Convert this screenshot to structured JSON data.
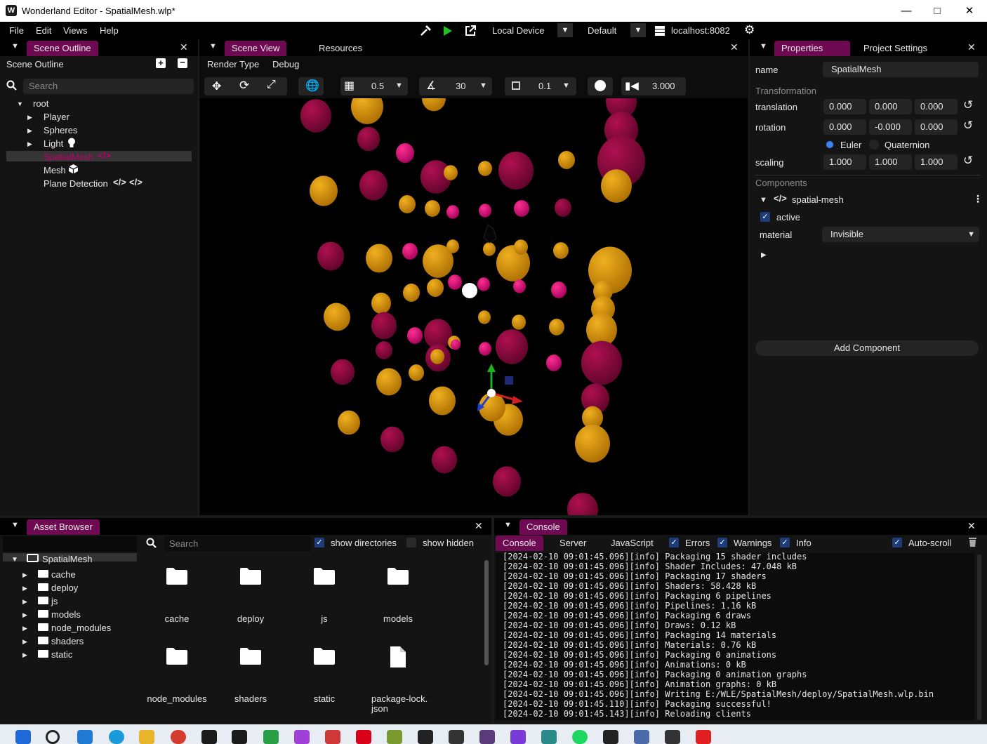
{
  "window": {
    "title": "Wonderland Editor - SpatialMesh.wlp*",
    "logo": "W"
  },
  "menu": [
    "File",
    "Edit",
    "Views",
    "Help"
  ],
  "toolbar": {
    "device": "Local Device",
    "profile": "Default",
    "server": "localhost:8082"
  },
  "scene_outline": {
    "tab": "Scene Outline",
    "header": "Scene Outline",
    "search_placeholder": "Search",
    "root": "root",
    "items": [
      {
        "label": "Player",
        "expandable": true
      },
      {
        "label": "Spheres",
        "expandable": true
      },
      {
        "label": "Light",
        "expandable": true,
        "icon": "light-bulb-icon"
      },
      {
        "label": "SpatialMesh",
        "selected": true,
        "icon": "code-icon"
      },
      {
        "label": "Mesh",
        "icon": "mesh-cube-icon"
      },
      {
        "label": "Plane Detection",
        "icon": "code-icon"
      }
    ]
  },
  "scene_view": {
    "tabs": [
      "Scene View",
      "Resources"
    ],
    "menu": [
      "Render Type",
      "Debug"
    ],
    "grid_size": "0.5",
    "angle_snap": "30",
    "scale_snap": "0.1",
    "camera_speed": "3.000"
  },
  "properties": {
    "tabs": [
      "Properties",
      "Project Settings"
    ],
    "name_label": "name",
    "name_value": "SpatialMesh",
    "transformation": "Transformation",
    "translation_label": "translation",
    "translation": [
      "0.000",
      "0.000",
      "0.000"
    ],
    "rotation_label": "rotation",
    "rotation": [
      "0.000",
      "-0.000",
      "0.000"
    ],
    "euler": "Euler",
    "quaternion": "Quaternion",
    "scaling_label": "scaling",
    "scaling": [
      "1.000",
      "1.000",
      "1.000"
    ],
    "components": "Components",
    "component_name": "spatial-mesh",
    "active_label": "active",
    "material_label": "material",
    "material_value": "Invisible",
    "add_component": "Add Component"
  },
  "asset_browser": {
    "tab": "Asset Browser",
    "search_placeholder": "Search",
    "show_directories": "show directories",
    "show_hidden": "show hidden",
    "tree_root": "SpatialMesh",
    "tree": [
      "cache",
      "deploy",
      "js",
      "models",
      "node_modules",
      "shaders",
      "static"
    ],
    "grid": [
      {
        "label": "cache",
        "kind": "folder"
      },
      {
        "label": "deploy",
        "kind": "folder"
      },
      {
        "label": "js",
        "kind": "folder"
      },
      {
        "label": "models",
        "kind": "folder"
      },
      {
        "label": "node_modules",
        "kind": "folder"
      },
      {
        "label": "shaders",
        "kind": "folder"
      },
      {
        "label": "static",
        "kind": "folder"
      },
      {
        "label": "package-lock.",
        "label2": "json",
        "kind": "file"
      }
    ]
  },
  "console": {
    "tab": "Console",
    "subtabs": [
      "Console",
      "Server",
      "JavaScript"
    ],
    "filters": [
      "Errors",
      "Warnings",
      "Info"
    ],
    "autoscroll": "Auto-scroll",
    "lines": [
      "[2024-02-10 09:01:45.096][info] Packaging 15 shader includes",
      "[2024-02-10 09:01:45.096][info] Shader Includes: 47.048 kB",
      "[2024-02-10 09:01:45.096][info] Packaging 17 shaders",
      "[2024-02-10 09:01:45.096][info] Shaders: 58.428 kB",
      "[2024-02-10 09:01:45.096][info] Packaging 6 pipelines",
      "[2024-02-10 09:01:45.096][info] Pipelines: 1.16 kB",
      "[2024-02-10 09:01:45.096][info] Packaging 6 draws",
      "[2024-02-10 09:01:45.096][info] Draws: 0.12 kB",
      "[2024-02-10 09:01:45.096][info] Packaging 14 materials",
      "[2024-02-10 09:01:45.096][info] Materials: 0.76 kB",
      "[2024-02-10 09:01:45.096][info] Packaging 0 animations",
      "[2024-02-10 09:01:45.096][info] Animations: 0 kB",
      "[2024-02-10 09:01:45.096][info] Packaging 0 animation graphs",
      "[2024-02-10 09:01:45.096][info] Animation graphs: 0 kB",
      "[2024-02-10 09:01:45.096][info] Writing E:/WLE/SpatialMesh/deploy/SpatialMesh.wlp.bin",
      "[2024-02-10 09:01:45.110][info] Packaging successful!",
      "[2024-02-10 09:01:45.143][info] Reloading clients"
    ]
  },
  "colors": {
    "accent": "#6e0a52",
    "magenta": "#c2006e",
    "gold": "#d7920a",
    "crimson": "#8a0a3c"
  }
}
